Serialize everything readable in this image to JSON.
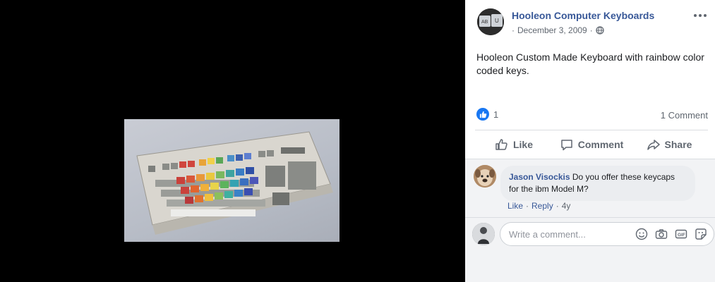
{
  "post": {
    "page_name": "Hooleon Computer Keyboards",
    "date": "December 3, 2009",
    "date_separator": "·",
    "text": "Hooleon Custom Made Keyboard with rainbow color coded keys.",
    "privacy_icon": "globe-icon",
    "more_icon": "more-options-icon"
  },
  "stats": {
    "like_count": "1",
    "comment_count": "1 Comment"
  },
  "actions": {
    "like": "Like",
    "comment": "Comment",
    "share": "Share"
  },
  "comment": {
    "author": "Jason Visockis",
    "text": "Do you offer these keycaps for the ibm Model M?",
    "like_label": "Like",
    "reply_label": "Reply",
    "separator": "·",
    "age": "4y"
  },
  "composer": {
    "placeholder": "Write a comment...",
    "icons": [
      "emoji-icon",
      "camera-icon",
      "gif-icon",
      "sticker-icon"
    ]
  },
  "colors": {
    "link_blue": "#385898",
    "like_blue": "#1877f2",
    "muted_text": "#606770"
  }
}
